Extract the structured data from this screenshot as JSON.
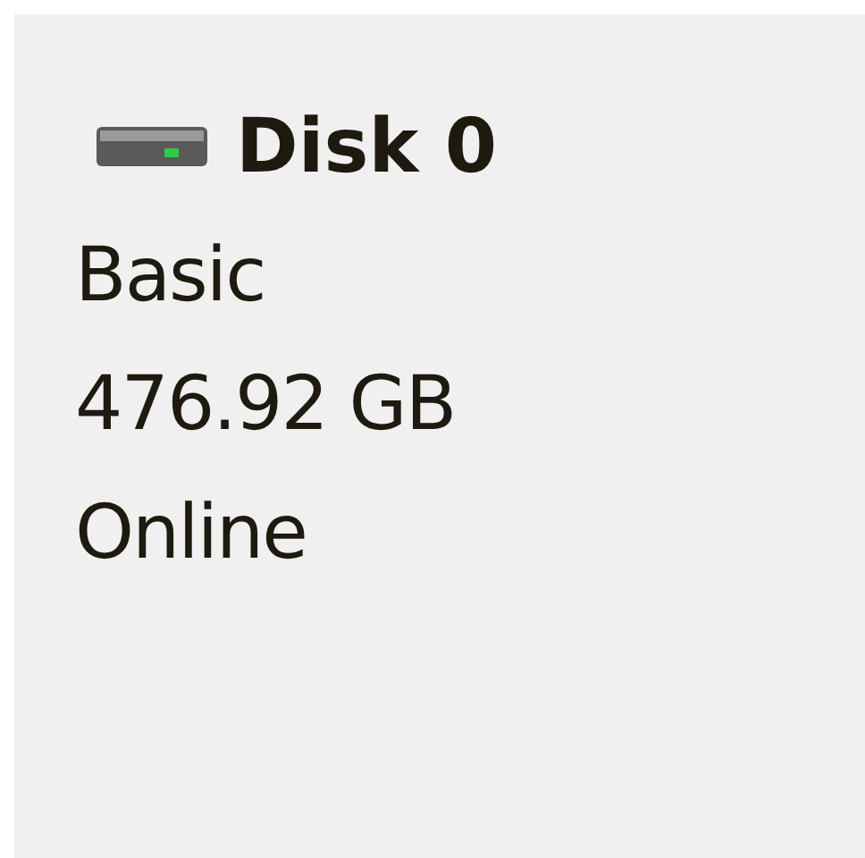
{
  "disk": {
    "title": "Disk 0",
    "type": "Basic",
    "size": "476.92 GB",
    "status": "Online"
  }
}
